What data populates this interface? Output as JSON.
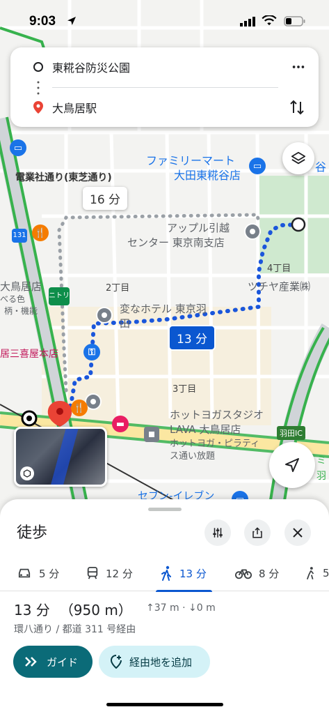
{
  "status_bar": {
    "time": "9:03"
  },
  "route": {
    "origin": "東糀谷防災公園",
    "destination": "大鳥居駅",
    "more_icon": "more-vert-icon",
    "swap_icon": "swap-vert-icon"
  },
  "map": {
    "labels": {
      "familymart": "ファミリーマート",
      "familymart2": "大田東糀谷店",
      "densha_dori": "電業社通り(東芝通り)",
      "apple1": "アップル引越",
      "apple2": "センター 東京南支店",
      "chome4": "4丁目",
      "chome2": "2丁目",
      "chome3": "3丁目",
      "otorii": "大鳥居店",
      "tsuchiya": "ツチヤ産業㈱",
      "henna1": "変なホテル 東京羽",
      "henna2": "田",
      "mikiya": "居三喜屋本店",
      "hotyoga1": "ホットヨガスタジオ",
      "hotyoga2": "LAVA 大鳥居店",
      "hotyoga3": "ホットヨガ・ピラティ",
      "hotyoga4": "ス通い放題",
      "seven": "セブン-イレブン",
      "haneda_ic": "羽田IC",
      "route131": "131",
      "nitori": "ニトリ",
      "taberu": "べる色",
      "gara": "柄・機能",
      "tani": "谷",
      "mi": "ミ",
      "ha": "羽"
    },
    "duration_alt": "16 分",
    "duration_main": "13 分"
  },
  "sheet": {
    "title": "徒歩",
    "modes": [
      {
        "icon": "car-icon",
        "label": "5 分"
      },
      {
        "icon": "train-icon",
        "label": "12 分"
      },
      {
        "icon": "walk-icon",
        "label": "13 分",
        "active": true
      },
      {
        "icon": "bike-icon",
        "label": "8 分"
      },
      {
        "icon": "ride-icon",
        "label": "5"
      }
    ],
    "duration": "13 分",
    "distance": "（950 m）",
    "elevation": "↑37 m · ↓0 m",
    "via": "環八通り / 都道 311 号経由",
    "guide_label": "ガイド",
    "add_stop_label": "経由地を追加"
  },
  "colors": {
    "accent": "#0b57d0",
    "route": "#1a56db",
    "guide": "#0b6b78"
  }
}
